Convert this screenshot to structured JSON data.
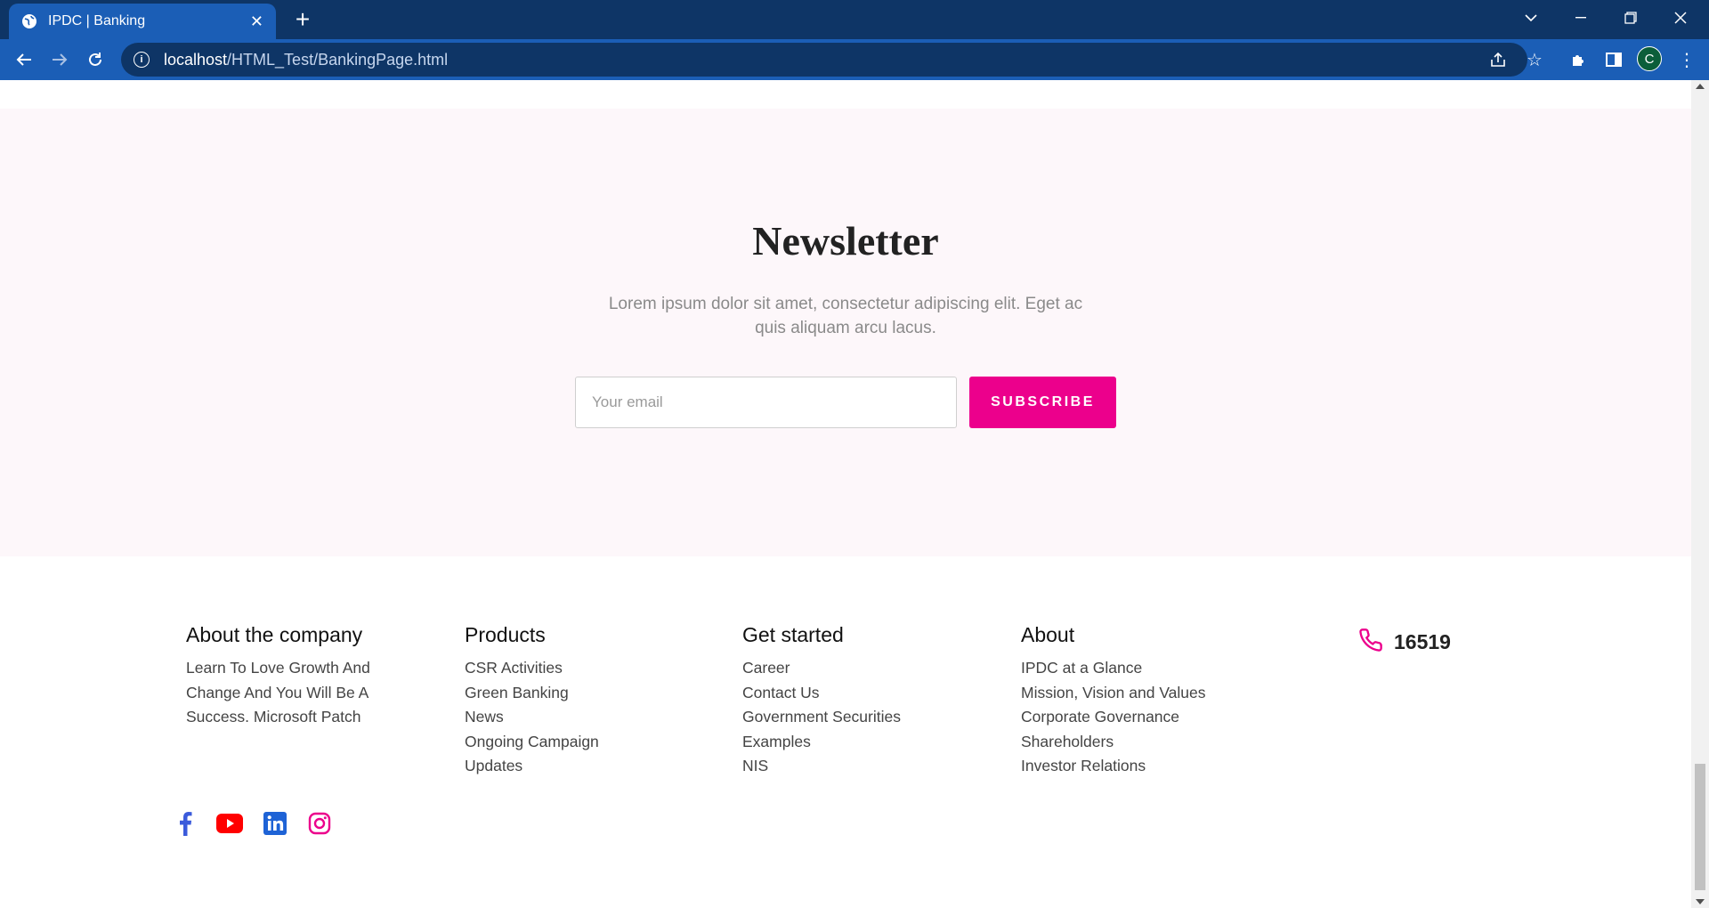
{
  "browser": {
    "tab_title": "IPDC | Banking",
    "url_host": "localhost",
    "url_path": "/HTML_Test/BankingPage.html",
    "avatar_letter": "C"
  },
  "newsletter": {
    "title": "Newsletter",
    "description": "Lorem ipsum dolor sit amet, consectetur adipiscing elit. Eget ac quis aliquam arcu lacus.",
    "email_placeholder": "Your email",
    "subscribe_label": "SUBSCRIBE"
  },
  "footer": {
    "about_company": {
      "heading": "About the company",
      "text": "Learn To Love Growth And Change And You Will Be A Success. Microsoft Patch"
    },
    "products": {
      "heading": "Products",
      "links": [
        "CSR Activities",
        "Green Banking",
        "News",
        "Ongoing Campaign",
        "Updates"
      ]
    },
    "get_started": {
      "heading": "Get started",
      "links": [
        "Career",
        "Contact Us",
        "Government Securities",
        "Examples",
        "NIS"
      ]
    },
    "about": {
      "heading": "About",
      "links": [
        "IPDC at a Glance",
        "Mission, Vision and Values",
        "Corporate Governance",
        "Shareholders",
        "Investor Relations"
      ]
    },
    "hotline": "16519"
  },
  "colors": {
    "accent": "#ec008c",
    "chrome_dark": "#0e3566",
    "chrome_light": "#1b5eb6",
    "newsletter_bg": "#fdf7fa"
  },
  "social_icons": [
    "facebook-icon",
    "youtube-icon",
    "linkedin-icon",
    "instagram-icon"
  ]
}
